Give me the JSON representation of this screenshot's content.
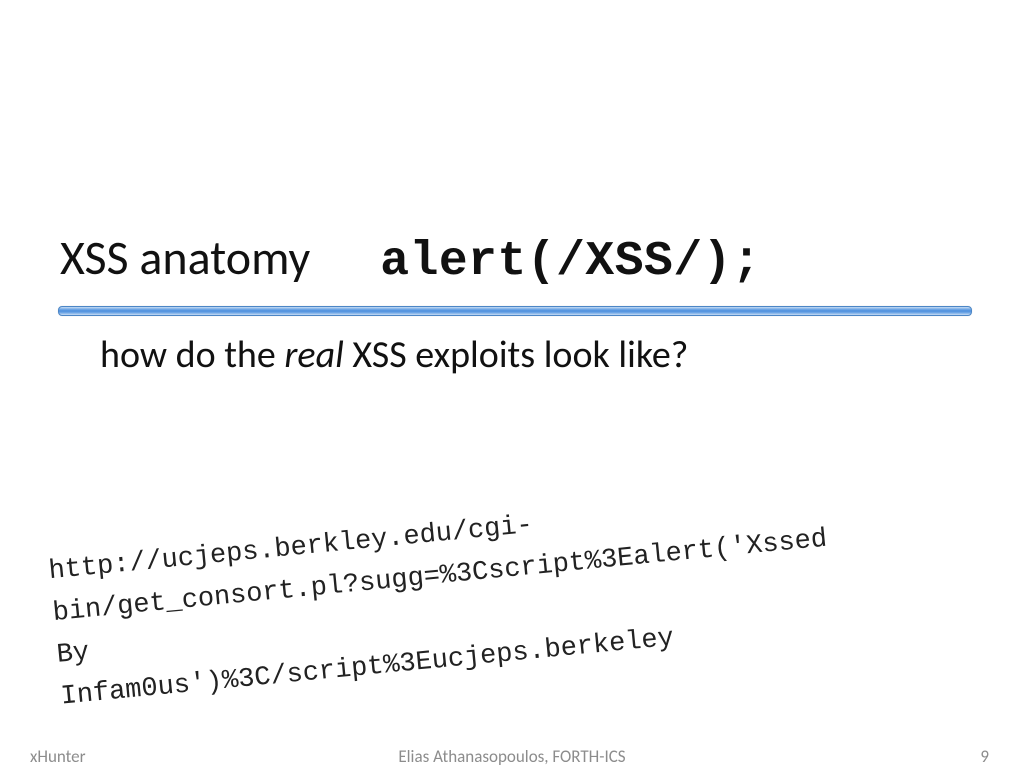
{
  "title": {
    "plain": "XSS anatomy",
    "code": "alert(/XSS/);"
  },
  "subtitle": {
    "pre": "how do the ",
    "emph": "real",
    "post": " XSS exploits look like?"
  },
  "url_text": "http://ucjeps.berkley.edu/cgi-\nbin/get_consort.pl?sugg=%3Cscript%3Ealert('Xssed \nBy \nInfam0us')%3C/script%3Eucjeps.berkeley",
  "footer": {
    "left": "xHunter",
    "center": "Elias Athanasopoulos, FORTH-ICS",
    "right": "9"
  }
}
